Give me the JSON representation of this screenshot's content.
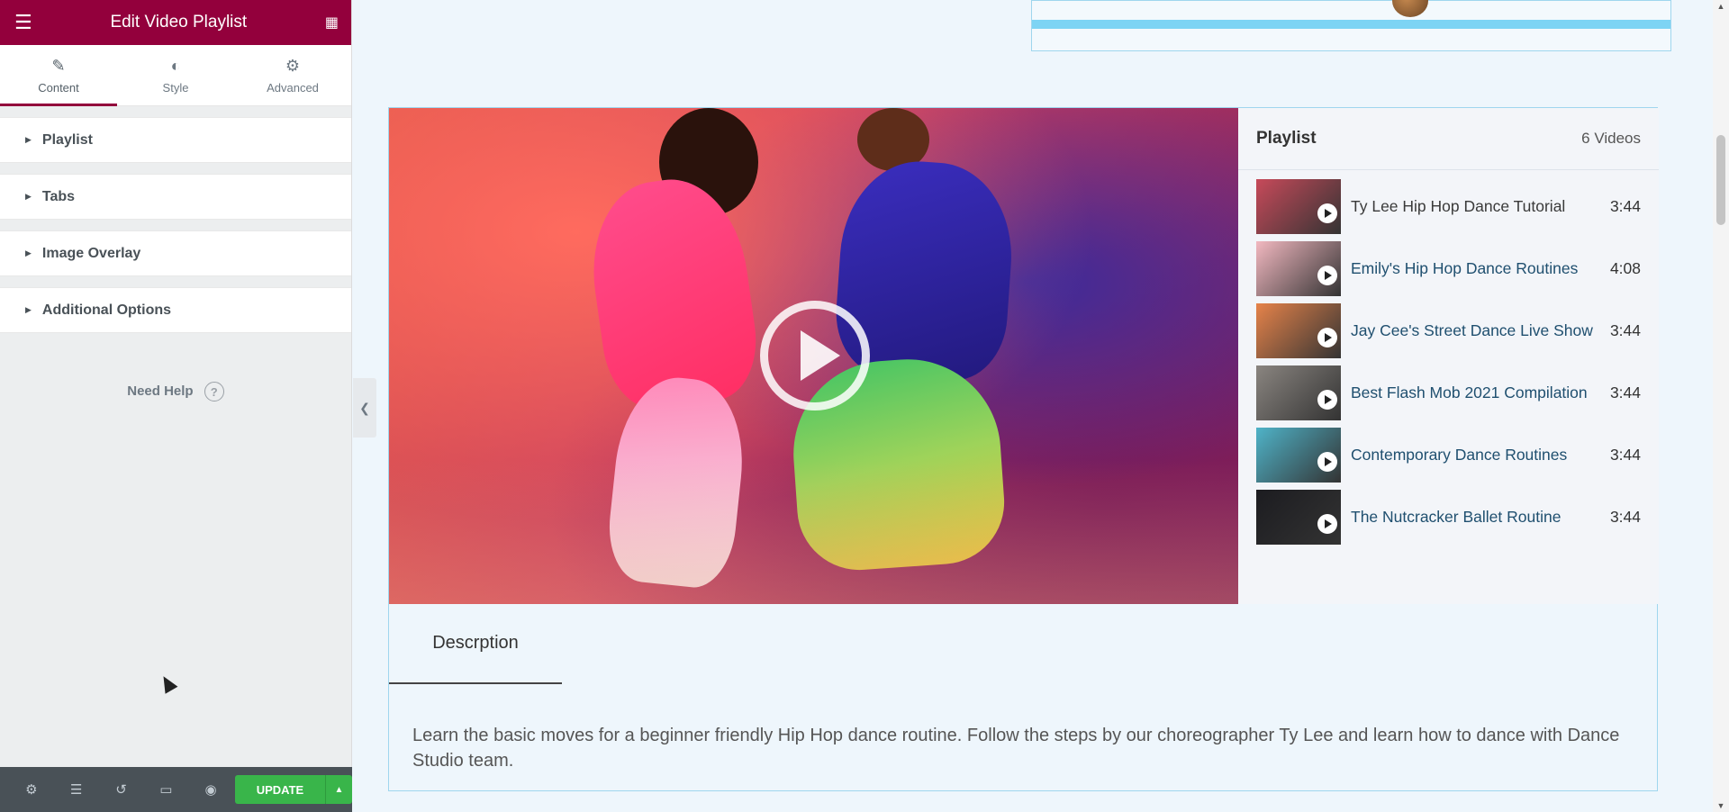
{
  "sidebar": {
    "title": "Edit Video Playlist",
    "tabs": [
      {
        "label": "Content",
        "icon": "pencil-icon"
      },
      {
        "label": "Style",
        "icon": "half-circle-icon"
      },
      {
        "label": "Advanced",
        "icon": "gear-icon"
      }
    ],
    "sections": [
      "Playlist",
      "Tabs",
      "Image Overlay",
      "Additional Options"
    ],
    "help_label": "Need Help",
    "footer": {
      "update_label": "UPDATE"
    }
  },
  "playlist": {
    "title": "Playlist",
    "count": "6 Videos",
    "items": [
      {
        "title": "Ty Lee Hip Hop Dance Tutorial",
        "duration": "3:44",
        "thumb_color": "#c74a5a"
      },
      {
        "title": "Emily's Hip Hop Dance Routines",
        "duration": "4:08",
        "thumb_color": "#f2b8c0"
      },
      {
        "title": "Jay Cee's Street Dance Live Show",
        "duration": "3:44",
        "thumb_color": "#e6834a"
      },
      {
        "title": "Best Flash Mob 2021 Compilation",
        "duration": "3:44",
        "thumb_color": "#8a8580"
      },
      {
        "title": "Contemporary Dance Routines",
        "duration": "3:44",
        "thumb_color": "#4fb3c8"
      },
      {
        "title": "The Nutcracker Ballet Routine",
        "duration": "3:44",
        "thumb_color": "#1c1c20"
      }
    ]
  },
  "description": {
    "tab_label": "Descrption",
    "text": "Learn the basic moves for a beginner friendly Hip Hop dance routine. Follow the steps by our choreographer Ty Lee and learn how to dance with Dance Studio team."
  },
  "colors": {
    "brand": "#93003c",
    "update_green": "#39b54a"
  }
}
